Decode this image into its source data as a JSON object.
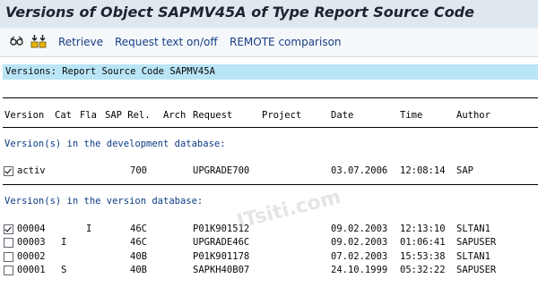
{
  "window": {
    "title": "Versions of Object SAPMV45A of Type Report Source Code"
  },
  "toolbar": {
    "icons": [
      "glasses-compare-icon",
      "split-compare-icon"
    ],
    "retrieve": "Retrieve",
    "request_text": "Request text on/off",
    "remote": "REMOTE comparison"
  },
  "banner": "Versions: Report Source Code SAPMV45A",
  "columns": {
    "version": "Version",
    "cat": "Cat",
    "fla": "Fla",
    "sap_rel": "SAP Rel.",
    "arch": "Arch",
    "request": "Request",
    "project": "Project",
    "date": "Date",
    "time": "Time",
    "author": "Author"
  },
  "sections": {
    "dev": "Version(s) in the development database:",
    "ver": "Version(s) in the version database:"
  },
  "dev_rows": [
    {
      "checked": true,
      "version": "activ",
      "cat": "",
      "fla": "",
      "rel": "700",
      "request": "UPGRADE700",
      "date": "03.07.2006",
      "time": "12:08:14",
      "author": "SAP"
    }
  ],
  "ver_rows": [
    {
      "checked": true,
      "version": "00004",
      "cat": "",
      "fla": "I",
      "rel": "46C",
      "request": "P01K901512",
      "date": "09.02.2003",
      "time": "12:13:10",
      "author": "SLTAN1"
    },
    {
      "checked": false,
      "version": "00003",
      "cat": "I",
      "fla": "",
      "rel": "46C",
      "request": "UPGRADE46C",
      "date": "09.02.2003",
      "time": "01:06:41",
      "author": "SAPUSER"
    },
    {
      "checked": false,
      "version": "00002",
      "cat": "",
      "fla": "",
      "rel": "40B",
      "request": "P01K901178",
      "date": "07.02.2003",
      "time": "15:53:38",
      "author": "SLTAN1"
    },
    {
      "checked": false,
      "version": "00001",
      "cat": "S",
      "fla": "",
      "rel": "40B",
      "request": "SAPKH40B07",
      "date": "24.10.1999",
      "time": "05:32:22",
      "author": "SAPUSER"
    }
  ],
  "watermark": "ITsiti.com"
}
